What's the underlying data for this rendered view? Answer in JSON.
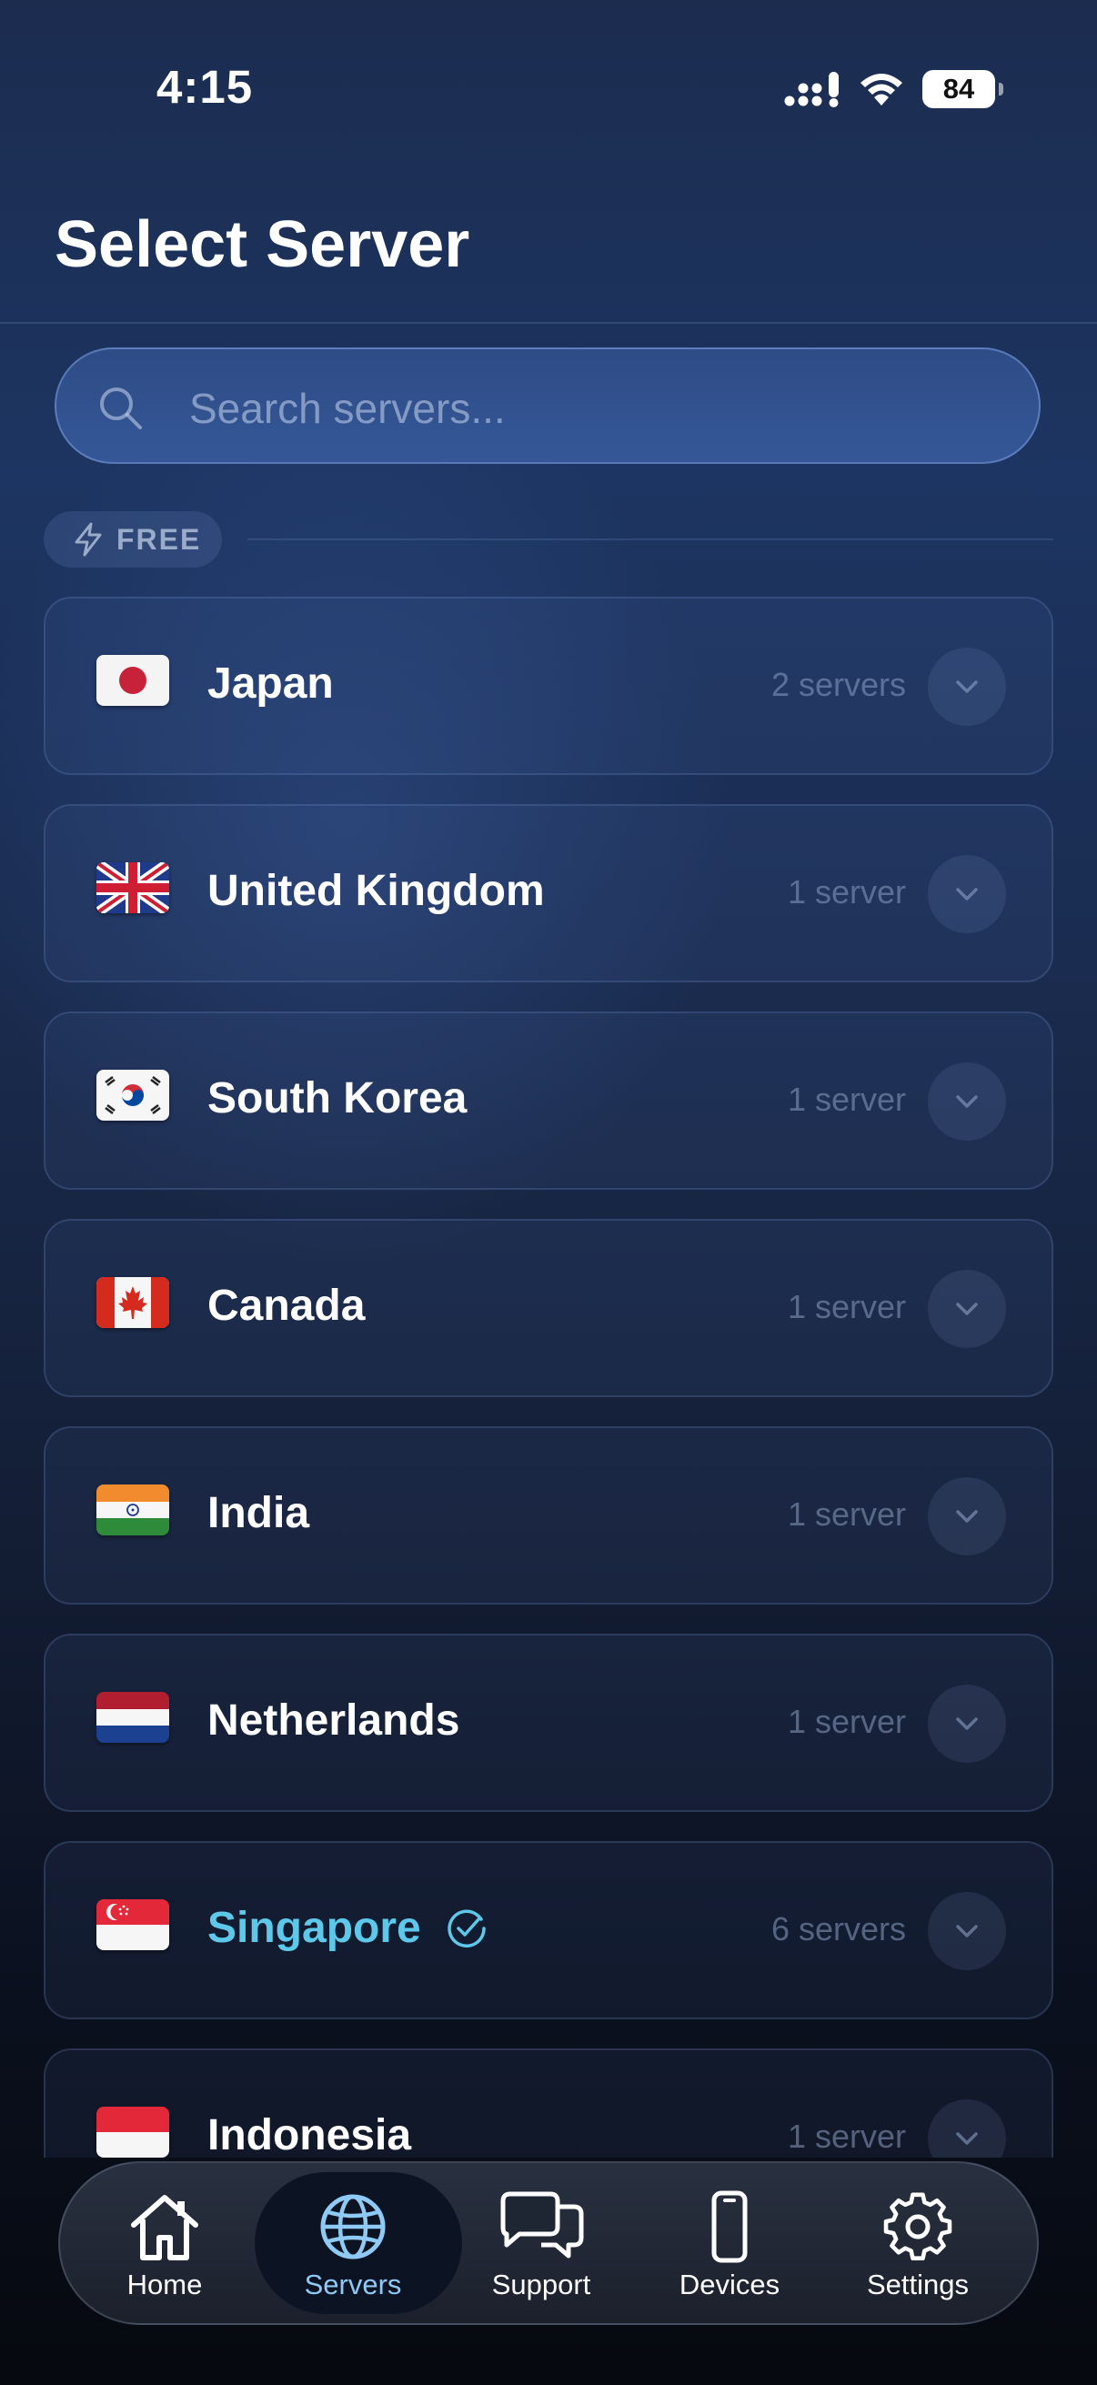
{
  "status_bar": {
    "time": "4:15",
    "battery": "84"
  },
  "header": {
    "title": "Select Server"
  },
  "search": {
    "placeholder": "Search servers..."
  },
  "section": {
    "label": "FREE"
  },
  "colors": {
    "accent": "#5ec8ea",
    "tab_active": "#8fcaf5"
  },
  "servers": [
    {
      "name": "Japan",
      "count": "2 servers",
      "flag": "japan-flag-icon"
    },
    {
      "name": "United Kingdom",
      "count": "1 server",
      "flag": "united-kingdom-flag-icon"
    },
    {
      "name": "South Korea",
      "count": "1 server",
      "flag": "south-korea-flag-icon"
    },
    {
      "name": "Canada",
      "count": "1 server",
      "flag": "canada-flag-icon"
    },
    {
      "name": "India",
      "count": "1 server",
      "flag": "india-flag-icon"
    },
    {
      "name": "Netherlands",
      "count": "1 server",
      "flag": "netherlands-flag-icon"
    },
    {
      "name": "Singapore",
      "count": "6 servers",
      "flag": "singapore-flag-icon",
      "selected": true
    },
    {
      "name": "Indonesia",
      "count": "1 server",
      "flag": "indonesia-flag-icon"
    }
  ],
  "tabs": [
    {
      "label": "Home",
      "icon": "home-icon"
    },
    {
      "label": "Servers",
      "icon": "globe-icon",
      "active": true
    },
    {
      "label": "Support",
      "icon": "chat-bubbles-icon"
    },
    {
      "label": "Devices",
      "icon": "phone-icon"
    },
    {
      "label": "Settings",
      "icon": "gear-icon"
    }
  ]
}
